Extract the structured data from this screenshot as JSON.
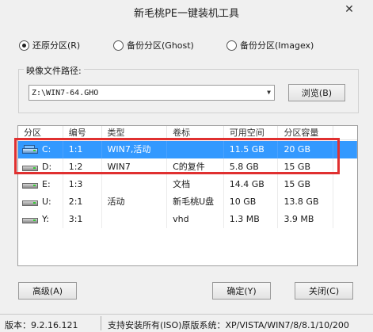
{
  "window": {
    "title": "新毛桃PE一键装机工具",
    "close_glyph": "✕"
  },
  "mode": {
    "options": [
      {
        "label": "还原分区(R)",
        "checked": true
      },
      {
        "label": "备份分区(Ghost)",
        "checked": false
      },
      {
        "label": "备份分区(Imagex)",
        "checked": false
      }
    ]
  },
  "image_path": {
    "label": "映像文件路径:",
    "value": "Z:\\WIN7-64.GHO",
    "browse_label": "浏览(B)"
  },
  "table": {
    "headers": [
      "分区",
      "编号",
      "类型",
      "卷标",
      "可用空间",
      "分区容量"
    ],
    "rows": [
      {
        "drive": "C:",
        "num": "1:1",
        "type": "WIN7,活动",
        "label": "",
        "free": "11.5 GB",
        "size": "20 GB",
        "icon": "system-drive-icon",
        "selected": true
      },
      {
        "drive": "D:",
        "num": "1:2",
        "type": "WIN7",
        "label": "C的复件",
        "free": "5.8 GB",
        "size": "15 GB",
        "icon": "drive-icon",
        "selected": false
      },
      {
        "drive": "E:",
        "num": "1:3",
        "type": "",
        "label": "文档",
        "free": "14.4 GB",
        "size": "15 GB",
        "icon": "drive-icon",
        "selected": false
      },
      {
        "drive": "U:",
        "num": "2:1",
        "type": "活动",
        "label": "新毛桃U盘",
        "free": "10 GB",
        "size": "13.8 GB",
        "icon": "drive-icon",
        "selected": false
      },
      {
        "drive": "Y:",
        "num": "3:1",
        "type": "",
        "label": "vhd",
        "free": "1.3 MB",
        "size": "3.9 MB",
        "icon": "drive-icon",
        "selected": false
      }
    ]
  },
  "buttons": {
    "advanced": "高级(A)",
    "ok": "确定(Y)",
    "close": "关闭(C)"
  },
  "status": {
    "version": "版本：9.2.16.121",
    "support": "支持安装所有(ISO)原版系统：XP/VISTA/WIN7/8/8.1/10/200"
  },
  "colors": {
    "selection": "#3399ff",
    "highlight": "#e03030"
  }
}
